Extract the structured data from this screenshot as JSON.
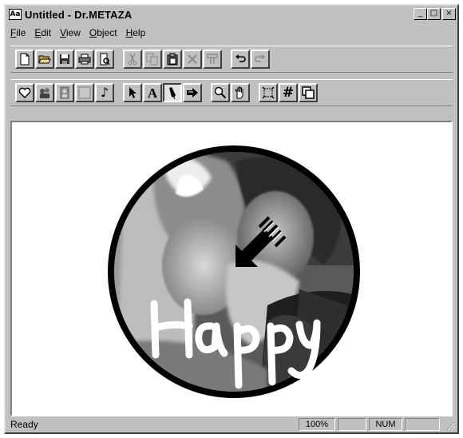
{
  "window": {
    "icon_label": "Aa",
    "title": "Untitled - Dr.METAZA",
    "controls": {
      "minimize": "_",
      "maximize": "□",
      "close": "×"
    }
  },
  "menu": [
    {
      "accel": "F",
      "rest": "ile"
    },
    {
      "accel": "E",
      "rest": "dit"
    },
    {
      "accel": "V",
      "rest": "iew"
    },
    {
      "accel": "O",
      "rest": "bject"
    },
    {
      "accel": "H",
      "rest": "elp"
    }
  ],
  "toolbar_standard": [
    {
      "icon": "new-document-icon",
      "state": "enabled"
    },
    {
      "icon": "open-folder-icon",
      "state": "enabled"
    },
    {
      "icon": "save-disk-icon",
      "state": "enabled"
    },
    {
      "icon": "print-icon",
      "state": "enabled"
    },
    {
      "icon": "print-preview-icon",
      "state": "enabled"
    },
    {
      "icon": "cut-icon",
      "state": "disabled"
    },
    {
      "icon": "copy-icon",
      "state": "disabled"
    },
    {
      "icon": "paste-icon",
      "state": "enabled"
    },
    {
      "icon": "delete-icon",
      "state": "disabled"
    },
    {
      "icon": "properties-icon",
      "state": "disabled"
    },
    {
      "icon": "undo-icon",
      "state": "enabled"
    },
    {
      "icon": "redo-icon",
      "state": "disabled"
    }
  ],
  "toolbar_tools": [
    {
      "icon": "heart-shape-icon"
    },
    {
      "icon": "clipart-icon"
    },
    {
      "icon": "picture-icon"
    },
    {
      "icon": "frame-icon"
    },
    {
      "icon": "music-note-icon",
      "glyph": "♪"
    },
    {
      "icon": "select-arrow-icon"
    },
    {
      "icon": "text-tool-icon",
      "glyph": "A"
    },
    {
      "icon": "pen-tool-icon",
      "state": "pressed"
    },
    {
      "icon": "stamp-arrow-icon"
    },
    {
      "icon": "zoom-icon"
    },
    {
      "icon": "hand-pan-icon"
    },
    {
      "icon": "fit-window-icon"
    },
    {
      "icon": "grid-icon",
      "glyph": "#"
    },
    {
      "icon": "layers-icon"
    }
  ],
  "canvas": {
    "image": "wedding-couple-photo-in-circle",
    "handwritten_text": "Happy",
    "colors": {
      "frame": "#000000",
      "ink": "#ffffff"
    }
  },
  "status": {
    "message": "Ready",
    "zoom": "100%",
    "caps": "",
    "num": "NUM",
    "scroll": ""
  }
}
